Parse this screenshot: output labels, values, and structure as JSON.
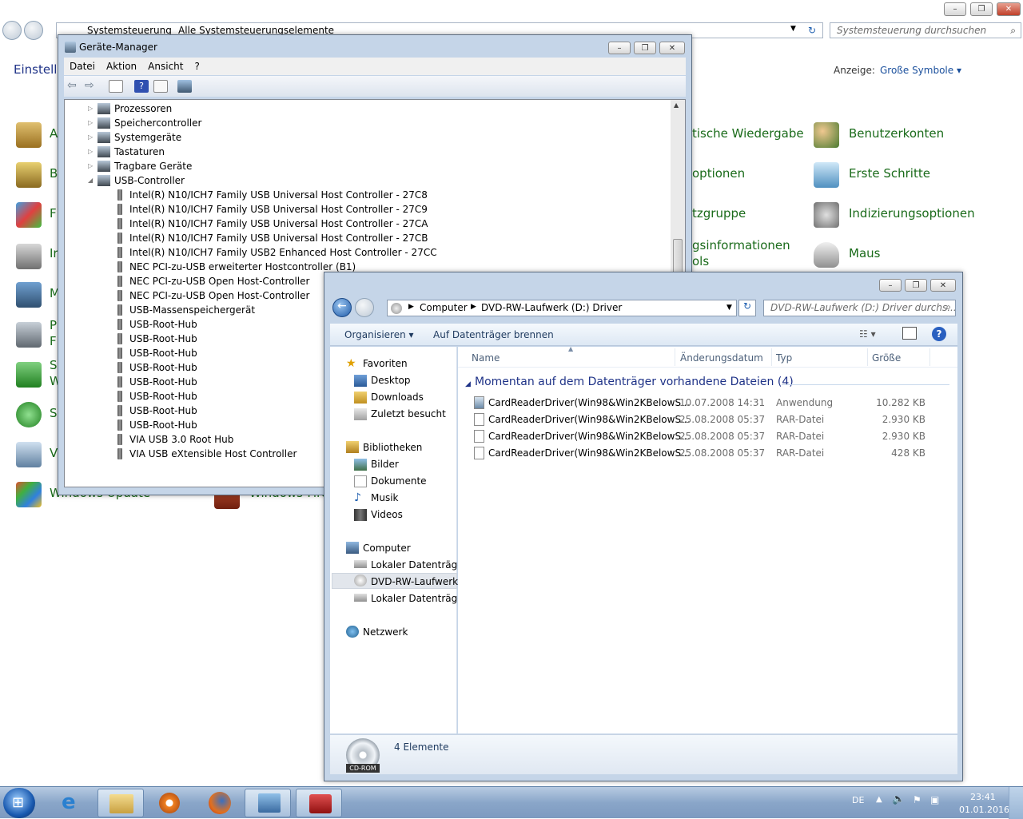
{
  "control_panel": {
    "breadcrumb": [
      "Systemsteuerung",
      "Alle Systemsteuerungselemente"
    ],
    "search_placeholder": "Systemsteuerung durchsuchen",
    "heading": "Einstellu",
    "view_label": "Anzeige:",
    "view_value": "Große Symbole",
    "left_items": [
      "A",
      "B",
      "F",
      "Ir",
      "M",
      "P",
      "F",
      "S",
      "W",
      "S",
      "V",
      "Windows Update"
    ],
    "middle_items": [
      "tische Wiedergabe",
      "optionen",
      "tzgruppe",
      "gsinformationen",
      "ols",
      "Windows-Fire"
    ],
    "right_items": [
      "Benutzerkonten",
      "Erste Schritte",
      "Indizierungsoptionen",
      "Maus"
    ]
  },
  "device_manager": {
    "title": "Geräte-Manager",
    "menu": [
      "Datei",
      "Aktion",
      "Ansicht",
      "?"
    ],
    "categories": [
      "Prozessoren",
      "Speichercontroller",
      "Systemgeräte",
      "Tastaturen",
      "Tragbare Geräte",
      "USB-Controller"
    ],
    "usb_devices": [
      "Intel(R) N10/ICH7 Family USB Universal Host Controller - 27C8",
      "Intel(R) N10/ICH7 Family USB Universal Host Controller - 27C9",
      "Intel(R) N10/ICH7 Family USB Universal Host Controller - 27CA",
      "Intel(R) N10/ICH7 Family USB Universal Host Controller - 27CB",
      "Intel(R) N10/ICH7 Family USB2 Enhanced Host Controller - 27CC",
      "NEC PCI-zu-USB erweiterter Hostcontroller (B1)",
      "NEC PCI-zu-USB Open Host-Controller",
      "NEC PCI-zu-USB Open Host-Controller",
      "USB-Massenspeichergerät",
      "USB-Root-Hub",
      "USB-Root-Hub",
      "USB-Root-Hub",
      "USB-Root-Hub",
      "USB-Root-Hub",
      "USB-Root-Hub",
      "USB-Root-Hub",
      "USB-Root-Hub",
      "VIA USB 3.0 Root Hub",
      "VIA USB eXtensible Host Controller"
    ]
  },
  "explorer": {
    "breadcrumb": [
      "Computer",
      "DVD-RW-Laufwerk (D:) Driver"
    ],
    "search_placeholder": "DVD-RW-Laufwerk (D:) Driver durchs...",
    "toolbar": {
      "organize": "Organisieren",
      "burn": "Auf Datenträger brennen"
    },
    "nav": {
      "favorites": "Favoriten",
      "favorites_items": [
        "Desktop",
        "Downloads",
        "Zuletzt besucht"
      ],
      "libraries": "Bibliotheken",
      "libraries_items": [
        "Bilder",
        "Dokumente",
        "Musik",
        "Videos"
      ],
      "computer": "Computer",
      "computer_items": [
        "Lokaler Datenträger",
        "DVD-RW-Laufwerk (",
        "Lokaler Datenträger"
      ],
      "network": "Netzwerk"
    },
    "columns": [
      "Name",
      "Änderungsdatum",
      "Typ",
      "Größe"
    ],
    "group_title": "Momentan auf dem Datenträger vorhandene Dateien (4)",
    "files": [
      {
        "name": "CardReaderDriver(Win98&Win2KBelowS...",
        "date": "10.07.2008 14:31",
        "type": "Anwendung",
        "size": "10.282 KB"
      },
      {
        "name": "CardReaderDriver(Win98&Win2KBelowS...",
        "date": "25.08.2008 05:37",
        "type": "RAR-Datei",
        "size": "2.930 KB"
      },
      {
        "name": "CardReaderDriver(Win98&Win2KBelowS...",
        "date": "25.08.2008 05:37",
        "type": "RAR-Datei",
        "size": "2.930 KB"
      },
      {
        "name": "CardReaderDriver(Win98&Win2KBelowS...",
        "date": "25.08.2008 05:37",
        "type": "RAR-Datei",
        "size": "428 KB"
      }
    ],
    "status": "4 Elemente",
    "status_icon_label": "CD-ROM"
  },
  "taskbar": {
    "language": "DE",
    "time": "23:41",
    "date": "01.01.2016"
  }
}
